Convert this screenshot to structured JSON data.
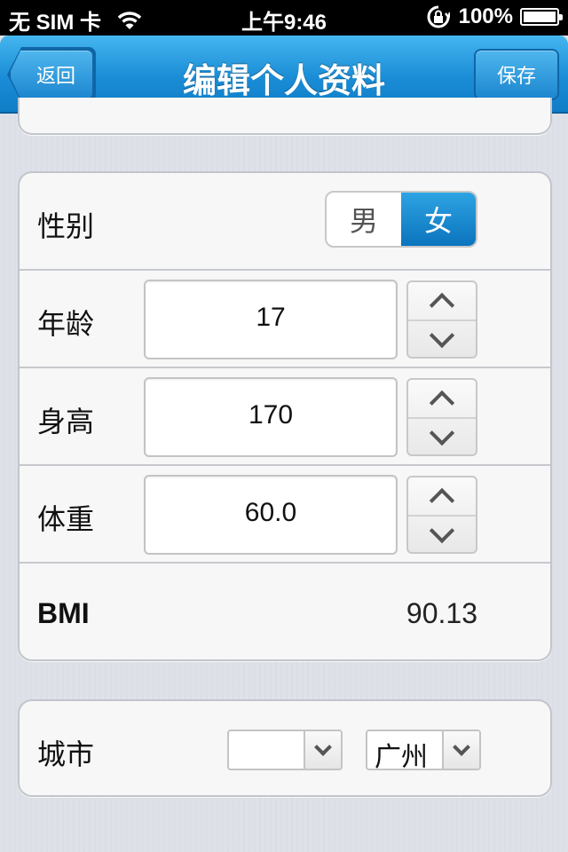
{
  "status_bar": {
    "carrier": "无 SIM 卡",
    "time": "上午9:46",
    "battery": "100%"
  },
  "nav": {
    "back_label": "返回",
    "title": "编辑个人资料",
    "save_label": "保存"
  },
  "profile": {
    "gender": {
      "label": "性别",
      "options": [
        "男",
        "女"
      ],
      "selected": "女"
    },
    "age": {
      "label": "年龄",
      "value": "17"
    },
    "height": {
      "label": "身高",
      "value": "170"
    },
    "weight": {
      "label": "体重",
      "value": "60.0"
    },
    "bmi": {
      "label": "BMI",
      "value": "90.13"
    }
  },
  "city": {
    "label": "城市",
    "province_value": "",
    "city_value": "广州"
  },
  "colors": {
    "accent": "#1a8dd6",
    "segment_active": "#0b74bd"
  },
  "icons": [
    "wifi-icon",
    "rotation-lock-icon",
    "battery-icon",
    "chevron-up-icon",
    "chevron-down-icon"
  ]
}
